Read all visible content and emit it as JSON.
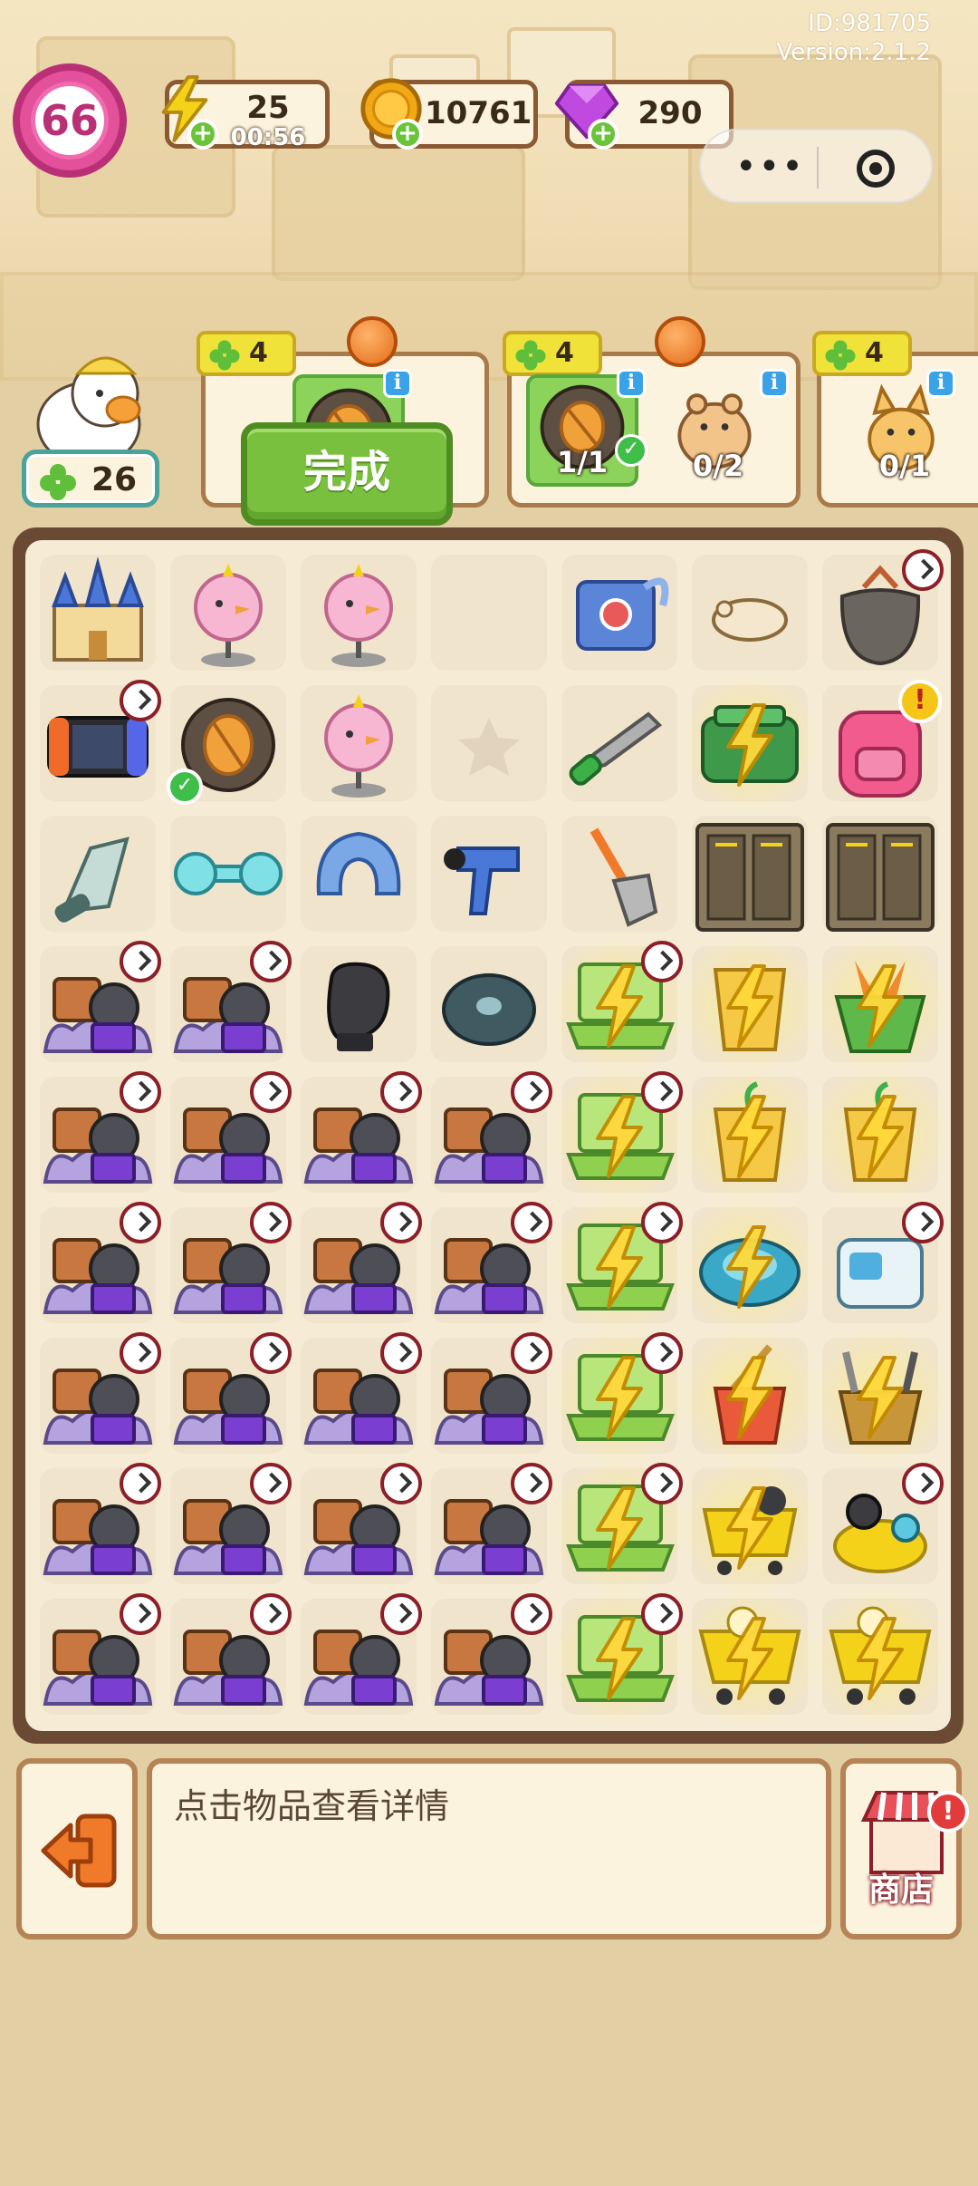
{
  "header": {
    "id_text": "ID:981705",
    "version_text": "Version:2.1.2",
    "level": "66",
    "energy": {
      "value": "25",
      "timer": "00:56"
    },
    "coins": {
      "value": "10761"
    },
    "gems": {
      "value": "290"
    },
    "colors": {
      "level_ring": "#e2519a",
      "energy": "#f5d21a",
      "coin": "#f0a814",
      "gem": "#c04ae0",
      "plus": "#6ac43a"
    }
  },
  "player": {
    "clover_count": "26"
  },
  "orders": [
    {
      "reward_clover": "4",
      "slots": [
        {
          "icon": "bug-mat-icon",
          "count": ""
        }
      ],
      "done_label": "完成"
    },
    {
      "reward_clover": "4",
      "slots": [
        {
          "icon": "bug-mat-icon",
          "count": "1/1"
        },
        {
          "icon": "hamster-icon",
          "count": "0/2"
        }
      ]
    },
    {
      "reward_clover": "4",
      "slots": [
        {
          "icon": "cat-icon",
          "count": "0/1"
        }
      ]
    }
  ],
  "board": {
    "rows": [
      [
        "castle",
        "pink-chick-statue",
        "pink-chick-statue",
        "empty",
        "game-console-box",
        "sleeping-hamster",
        "cat-litter-bag"
      ],
      [
        "handheld-console",
        "bug-mat",
        "pink-chick-statue",
        "star-slot",
        "hacksaw",
        "green-case-energy",
        "pink-backpack"
      ],
      [
        "grip-trainer",
        "dumbbell",
        "neck-pillow",
        "massage-gun",
        "shovel",
        "locker",
        "locker"
      ],
      [
        "treasure-pile",
        "treasure-pile",
        "boxing-glove",
        "weight-plate",
        "laptop-energy",
        "cup-energy",
        "carrot-basket-energy"
      ],
      [
        "treasure-pile",
        "treasure-pile",
        "treasure-pile",
        "treasure-pile",
        "laptop-energy",
        "plant-cup-energy",
        "plant-cup-energy"
      ],
      [
        "treasure-pile",
        "treasure-pile",
        "treasure-pile",
        "treasure-pile",
        "laptop-energy",
        "robot-vacuum-energy",
        "mop-station"
      ],
      [
        "treasure-pile",
        "treasure-pile",
        "treasure-pile",
        "treasure-pile",
        "laptop-energy",
        "broom-bucket-energy",
        "tool-bucket-energy"
      ],
      [
        "treasure-pile",
        "treasure-pile",
        "treasure-pile",
        "treasure-pile",
        "laptop-energy",
        "cart-energy",
        "fishing-tackle"
      ],
      [
        "treasure-pile",
        "treasure-pile",
        "treasure-pile",
        "treasure-pile",
        "laptop-energy",
        "shopping-cart-energy",
        "shopping-cart-energy"
      ]
    ],
    "clock_cells": [
      "0-6",
      "1-0",
      "3-0",
      "3-1",
      "3-4",
      "4-0",
      "4-1",
      "4-2",
      "4-3",
      "4-4",
      "5-0",
      "5-1",
      "5-2",
      "5-3",
      "5-4",
      "5-6",
      "6-0",
      "6-1",
      "6-2",
      "6-3",
      "6-4",
      "7-0",
      "7-1",
      "7-2",
      "7-3",
      "7-4",
      "7-6",
      "8-0",
      "8-1",
      "8-2",
      "8-3",
      "8-4"
    ],
    "glow_cells": [
      "1-5",
      "3-4",
      "3-5",
      "3-6",
      "4-4",
      "4-5",
      "4-6",
      "5-4",
      "5-5",
      "6-4",
      "6-5",
      "6-6",
      "7-4",
      "7-5",
      "8-4",
      "8-5",
      "8-6"
    ]
  },
  "bottom": {
    "hint": "点击物品查看详情",
    "shop_label": "商店"
  }
}
